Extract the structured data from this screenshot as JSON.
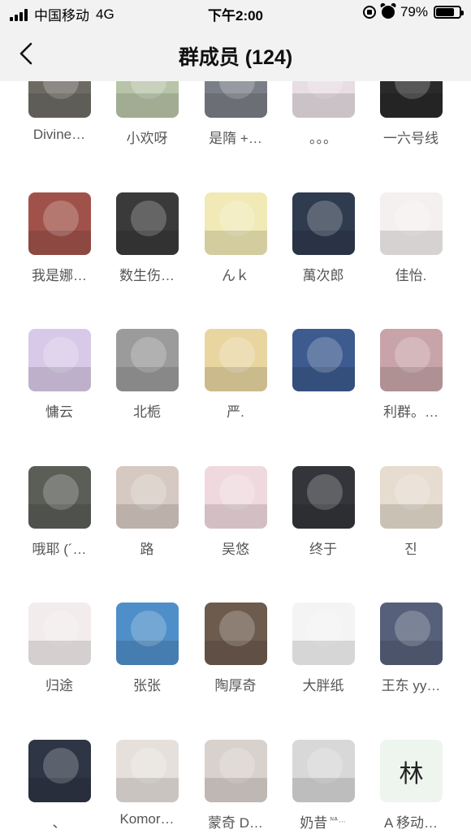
{
  "status_bar": {
    "carrier": "中国移动",
    "network": "4G",
    "time": "下午2:00",
    "battery": "79%",
    "battery_level": 0.79,
    "icons": [
      "signal-icon",
      "rotation-lock-icon",
      "alarm-icon",
      "battery-icon"
    ]
  },
  "navbar": {
    "title": "群成员 (124)",
    "back_icon": "chevron-left-icon"
  },
  "members": [
    {
      "name": "Divine…",
      "color": "#6d6a63"
    },
    {
      "name": "小欢呀",
      "color": "#b8c4a8"
    },
    {
      "name": "是隋 +…",
      "color": "#7a7e86"
    },
    {
      "name": "。。。",
      "color": "#e8dde3"
    },
    {
      "name": "一六号线",
      "color": "#2a2a2a"
    },
    {
      "name": "我是娜…",
      "color": "#a0524a"
    },
    {
      "name": "数生伤…",
      "color": "#3a3a3a"
    },
    {
      "name": "んｋ",
      "color": "#f1e9b6"
    },
    {
      "name": "萬次郎",
      "color": "#2f3b4f"
    },
    {
      "name": "佳怡.",
      "color": "#f4f0ef"
    },
    {
      "name": "慵云",
      "color": "#d9c9e8"
    },
    {
      "name": "北栀",
      "color": "#9b9b9b"
    },
    {
      "name": "严.",
      "color": "#e8d5a0"
    },
    {
      "name": "",
      "color": "#3d5b8f"
    },
    {
      "name": "利群。…",
      "color": "#c8a4a8"
    },
    {
      "name": "哦耶 (´…",
      "color": "#5a5e57"
    },
    {
      "name": "路",
      "color": "#d6c9c2"
    },
    {
      "name": "吴悠",
      "color": "#efd9de"
    },
    {
      "name": "终于",
      "color": "#34353a"
    },
    {
      "name": "진",
      "color": "#e6dccf"
    },
    {
      "name": "归途",
      "color": "#f3ecec"
    },
    {
      "name": "张张",
      "color": "#4f8fc9"
    },
    {
      "name": "陶厚奇",
      "color": "#6d5b4e"
    },
    {
      "name": "大胖纸",
      "color": "#f4f4f4"
    },
    {
      "name": "王东 yy…",
      "color": "#56607a"
    },
    {
      "name": "、",
      "color": "#2e3544"
    },
    {
      "name": "Komor…",
      "color": "#e6e0dc"
    },
    {
      "name": "蒙奇 D…",
      "color": "#d9d1cc"
    },
    {
      "name": "奶昔",
      "name_suffix": "ᴺᴬ…",
      "color": "#d8d8d8"
    },
    {
      "name": "A 移动…",
      "color": "#eef4ee",
      "avatar_text": "林"
    }
  ]
}
